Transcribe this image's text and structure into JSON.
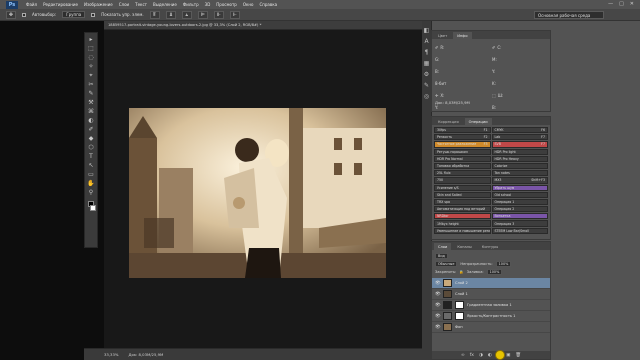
{
  "menubar": {
    "logo": "Ps",
    "items": [
      "Файл",
      "Редактирование",
      "Изображение",
      "Слои",
      "Текст",
      "Выделение",
      "Фильтр",
      "3D",
      "Просмотр",
      "Окно",
      "Справка"
    ],
    "window_controls": [
      "—",
      "□",
      "✕"
    ]
  },
  "optionsbar": {
    "auto_label": "Автовыбор:",
    "auto_value": "Группа",
    "show_controls_label": "Показать упр. элем.",
    "workspace": "Основная рабочая среда"
  },
  "document": {
    "tab_title": "18859517-portrait-vintage-young-lovers-outdoors-2.jpg @ 33,3% (Слой 2, RGB/8#) *"
  },
  "tools": [
    "▸",
    "⬚",
    "◌",
    "✧",
    "⌖",
    "✂",
    "✎",
    "⚒",
    "⌘",
    "◐",
    "✐",
    "◆",
    "⬡",
    "T",
    "↖",
    "▭",
    "✋",
    "⚲"
  ],
  "status": {
    "zoom": "33,33%",
    "doc_size": "Док: 8,03M/25,9M"
  },
  "right_strip_icons": [
    "◧",
    "A",
    "¶",
    "▦",
    "⚙",
    "✎",
    "◎"
  ],
  "info_panel": {
    "tabs": [
      "Цвет",
      "Инфо"
    ],
    "cells": [
      {
        "icon": "✐",
        "label": "R:"
      },
      {
        "icon": "✐",
        "label": "C:"
      },
      {
        "icon": "",
        "label": "G:"
      },
      {
        "icon": "",
        "label": "M:"
      },
      {
        "icon": "",
        "label": "B:"
      },
      {
        "icon": "",
        "label": "Y:"
      },
      {
        "icon": "",
        "label": "8-бит"
      },
      {
        "icon": "",
        "label": "K:"
      },
      {
        "icon": "✛",
        "label": "X:"
      },
      {
        "icon": "⬚",
        "label": "Ш:"
      },
      {
        "icon": "",
        "label": "Y:"
      },
      {
        "icon": "",
        "label": "В:"
      }
    ],
    "footer": "Док: 8,03M/25,9M"
  },
  "actions_panel": {
    "tabs": [
      "Коррекция",
      "Операции"
    ],
    "buttons": [
      {
        "label": "30fps",
        "key": "F1",
        "color": "#3d3d3d"
      },
      {
        "label": "CMYK",
        "key": "F6",
        "color": "#3d3d3d"
      },
      {
        "label": "Резкость",
        "key": "F2",
        "color": "#3d3d3d"
      },
      {
        "label": "Lab",
        "key": "F7",
        "color": "#3d3d3d"
      },
      {
        "label": "Частотное разложение",
        "key": "F3",
        "color": "#d08a2a"
      },
      {
        "label": "SVB",
        "key": "F7",
        "color": "#c04848"
      },
      {
        "label": "Ретушь порошком",
        "key": "",
        "color": "#3d3d3d"
      },
      {
        "label": "HDR Pro light",
        "key": "",
        "color": "#3d3d3d"
      },
      {
        "label": "HDR Pro Normal",
        "key": "",
        "color": "#3d3d3d"
      },
      {
        "label": "HDR Pro Heavy",
        "key": "",
        "color": "#3d3d3d"
      },
      {
        "label": "Тоновая обработка",
        "key": "",
        "color": "#3d3d3d"
      },
      {
        "label": "Colorize",
        "key": "",
        "color": "#3d3d3d"
      },
      {
        "label": "25L fluix",
        "key": "",
        "color": "#3d3d3d"
      },
      {
        "label": "Tan notes",
        "key": "",
        "color": "#3d3d3d"
      },
      {
        "label": "750",
        "key": "",
        "color": "#3d3d3d"
      },
      {
        "label": "MX3",
        "key": "Shift+F3",
        "color": "#3d3d3d"
      },
      {
        "label": "Усиление s/S",
        "key": "",
        "color": "#3d3d3d"
      },
      {
        "label": "Убрать шум",
        "key": "",
        "color": "#7a55a8"
      },
      {
        "label": "Skin and Sailed",
        "key": "",
        "color": "#3d3d3d"
      },
      {
        "label": "Old school",
        "key": "",
        "color": "#3d3d3d"
      },
      {
        "label": "TRX spa",
        "key": "",
        "color": "#3d3d3d"
      },
      {
        "label": "Операция 1",
        "key": "",
        "color": "#3d3d3d"
      },
      {
        "label": "Автоматизация под веторий",
        "key": "",
        "color": "#3d3d3d"
      },
      {
        "label": "Операция 2",
        "key": "",
        "color": "#3d3d3d"
      },
      {
        "label": "NRDtor",
        "key": "",
        "color": "#c04848"
      },
      {
        "label": "Виньетка",
        "key": "",
        "color": "#7a55a8"
      },
      {
        "label": "1Mbyx height",
        "key": "",
        "color": "#3d3d3d"
      },
      {
        "label": "Операция 3",
        "key": "",
        "color": "#3d3d3d"
      },
      {
        "label": "Уменьшение и повышение резк.",
        "key": "",
        "color": "#3d3d3d"
      },
      {
        "label": "STEEM Low Bar/Smoll",
        "key": "",
        "color": "#3d3d3d"
      }
    ]
  },
  "layers_panel": {
    "tabs": [
      "Слои",
      "Каналы",
      "Контуры"
    ],
    "kind_label": "Вид",
    "blend_mode": "Обычные",
    "opacity_label": "Непрозрачность:",
    "opacity_value": "100%",
    "lock_label": "Закрепить:",
    "fill_label": "Заливка:",
    "fill_value": "100%",
    "layers": [
      {
        "name": "Слой 2",
        "thumb": "#c9a97a",
        "has_mask": false,
        "active": true
      },
      {
        "name": "Слой 1",
        "thumb": "#5a4a38",
        "has_mask": false,
        "active": false
      },
      {
        "name": "Градиентная заливка 1",
        "thumb": "#222222",
        "has_mask": true,
        "active": false
      },
      {
        "name": "Яркость/Контрастность 1",
        "thumb": "#6a6a6a",
        "has_mask": true,
        "active": false
      },
      {
        "name": "Фон",
        "thumb": "#8a7050",
        "has_mask": false,
        "active": false
      }
    ],
    "bottom_icons": [
      "∞",
      "fx",
      "◑",
      "◐",
      "▭",
      "▣",
      "🗑"
    ]
  }
}
